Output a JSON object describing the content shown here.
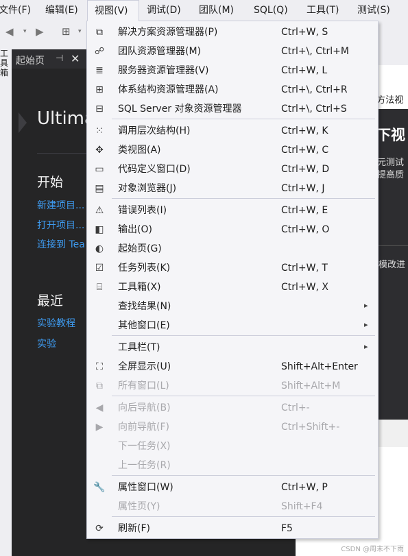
{
  "menubar": [
    {
      "label": "文件(F)"
    },
    {
      "label": "编辑(E)"
    },
    {
      "label": "视图(V)"
    },
    {
      "label": "调试(D)"
    },
    {
      "label": "团队(M)"
    },
    {
      "label": "SQL(Q)"
    },
    {
      "label": "工具(T)"
    },
    {
      "label": "测试(S)"
    }
  ],
  "left_strip_label": "工具箱",
  "tab": {
    "label": "起始页",
    "pin": "⊣",
    "close": "✕"
  },
  "start_page": {
    "title": "Ultima",
    "start_heading": "开始",
    "start_links": [
      "新建项目...",
      "打开项目...",
      "连接到 Tea"
    ],
    "recent_heading": "最近",
    "recent_links": [
      "实验教程",
      "实验"
    ]
  },
  "right_pane": {
    "top_text": "E方法视",
    "dark_heading": "下视",
    "dark_text_1": "元测试",
    "dark_text_2": "提高质",
    "dark_text_3": "模改进"
  },
  "menu": {
    "items": [
      {
        "label": "解决方案资源管理器(P)",
        "shortcut": "Ctrl+W, S",
        "icon": "solution-explorer-icon",
        "glyph": "⧉"
      },
      {
        "label": "团队资源管理器(M)",
        "shortcut": "Ctrl+\\, Ctrl+M",
        "icon": "team-explorer-icon",
        "glyph": "☍"
      },
      {
        "label": "服务器资源管理器(V)",
        "shortcut": "Ctrl+W, L",
        "icon": "server-explorer-icon",
        "glyph": "≣"
      },
      {
        "label": "体系结构资源管理器(A)",
        "shortcut": "Ctrl+\\, Ctrl+R",
        "icon": "architecture-explorer-icon",
        "glyph": "⊞"
      },
      {
        "label": "SQL Server 对象资源管理器",
        "shortcut": "Ctrl+\\, Ctrl+S",
        "icon": "sql-server-explorer-icon",
        "glyph": "⊟"
      },
      {
        "label": "调用层次结构(H)",
        "shortcut": "Ctrl+W, K",
        "icon": "call-hierarchy-icon",
        "glyph": "⁙"
      },
      {
        "label": "类视图(A)",
        "shortcut": "Ctrl+W, C",
        "icon": "class-view-icon",
        "glyph": "✥"
      },
      {
        "label": "代码定义窗口(D)",
        "shortcut": "Ctrl+W, D",
        "icon": "code-definition-icon",
        "glyph": "▭"
      },
      {
        "label": "对象浏览器(J)",
        "shortcut": "Ctrl+W, J",
        "icon": "object-browser-icon",
        "glyph": "▤"
      },
      {
        "label": "错误列表(I)",
        "shortcut": "Ctrl+W, E",
        "icon": "error-list-icon",
        "glyph": "⚠"
      },
      {
        "label": "输出(O)",
        "shortcut": "Ctrl+W, O",
        "icon": "output-icon",
        "glyph": "◧"
      },
      {
        "label": "起始页(G)",
        "shortcut": "",
        "icon": "start-page-icon",
        "glyph": "◐"
      },
      {
        "label": "任务列表(K)",
        "shortcut": "Ctrl+W, T",
        "icon": "task-list-icon",
        "glyph": "☑"
      },
      {
        "label": "工具箱(X)",
        "shortcut": "Ctrl+W, X",
        "icon": "toolbox-icon",
        "glyph": "⌸"
      },
      {
        "label": "查找结果(N)",
        "shortcut": "",
        "icon": "",
        "glyph": "",
        "submenu": "▸"
      },
      {
        "label": "其他窗口(E)",
        "shortcut": "",
        "icon": "",
        "glyph": "",
        "submenu": "▸"
      },
      {
        "label": "工具栏(T)",
        "shortcut": "",
        "icon": "",
        "glyph": "",
        "submenu": "▸"
      },
      {
        "label": "全屏显示(U)",
        "shortcut": "Shift+Alt+Enter",
        "icon": "full-screen-icon",
        "glyph": "⛶"
      },
      {
        "label": "所有窗口(L)",
        "shortcut": "Shift+Alt+M",
        "icon": "all-windows-icon",
        "glyph": "⧉",
        "disabled": true
      },
      {
        "label": "向后导航(B)",
        "shortcut": "Ctrl+-",
        "icon": "navigate-back-icon",
        "glyph": "◀",
        "disabled": true
      },
      {
        "label": "向前导航(F)",
        "shortcut": "Ctrl+Shift+-",
        "icon": "navigate-forward-icon",
        "glyph": "▶",
        "disabled": true
      },
      {
        "label": "下一任务(X)",
        "shortcut": "",
        "icon": "",
        "glyph": "",
        "disabled": true
      },
      {
        "label": "上一任务(R)",
        "shortcut": "",
        "icon": "",
        "glyph": "",
        "disabled": true
      },
      {
        "label": "属性窗口(W)",
        "shortcut": "Ctrl+W, P",
        "icon": "properties-wrench-icon",
        "glyph": "🔧"
      },
      {
        "label": "属性页(Y)",
        "shortcut": "Shift+F4",
        "icon": "",
        "glyph": "",
        "disabled": true
      },
      {
        "label": "刷新(F)",
        "shortcut": "F5",
        "icon": "refresh-icon",
        "glyph": "⟳"
      }
    ]
  },
  "watermark": "CSDN @周末不下雨"
}
